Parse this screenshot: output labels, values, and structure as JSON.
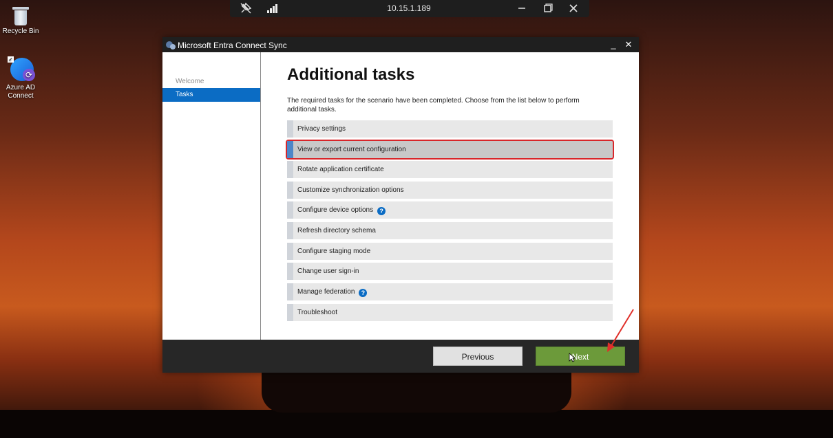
{
  "remote_bar": {
    "ip": "10.15.1.189",
    "icons": [
      "unpin-icon",
      "signal-icon",
      "minimize-icon",
      "restore-icon",
      "close-icon"
    ]
  },
  "desktop": {
    "recycle_bin_label": "Recycle Bin",
    "azure_ad_label": "Azure AD Connect"
  },
  "window": {
    "title": "Microsoft Entra Connect Sync",
    "min_glyph": "_",
    "close_glyph": "✕"
  },
  "sidebar": {
    "items": [
      {
        "label": "Welcome",
        "active": false
      },
      {
        "label": "Tasks",
        "active": true
      }
    ]
  },
  "main": {
    "heading": "Additional tasks",
    "description": "The required tasks for the scenario have been completed. Choose from the list below to perform additional tasks.",
    "tasks": [
      {
        "label": "Privacy settings",
        "help": false
      },
      {
        "label": "View or export current configuration",
        "help": false,
        "selected": true
      },
      {
        "label": "Rotate application certificate",
        "help": false
      },
      {
        "label": "Customize synchronization options",
        "help": false
      },
      {
        "label": "Configure device options",
        "help": true
      },
      {
        "label": "Refresh directory schema",
        "help": false
      },
      {
        "label": "Configure staging mode",
        "help": false
      },
      {
        "label": "Change user sign-in",
        "help": false
      },
      {
        "label": "Manage federation",
        "help": true
      },
      {
        "label": "Troubleshoot",
        "help": false
      }
    ],
    "help_glyph": "?"
  },
  "footer": {
    "previous_label": "Previous",
    "next_label": "Next"
  },
  "colors": {
    "accent": "#0b6cc4",
    "next_button": "#6c9a3a",
    "highlight_outline": "#d8262a"
  }
}
